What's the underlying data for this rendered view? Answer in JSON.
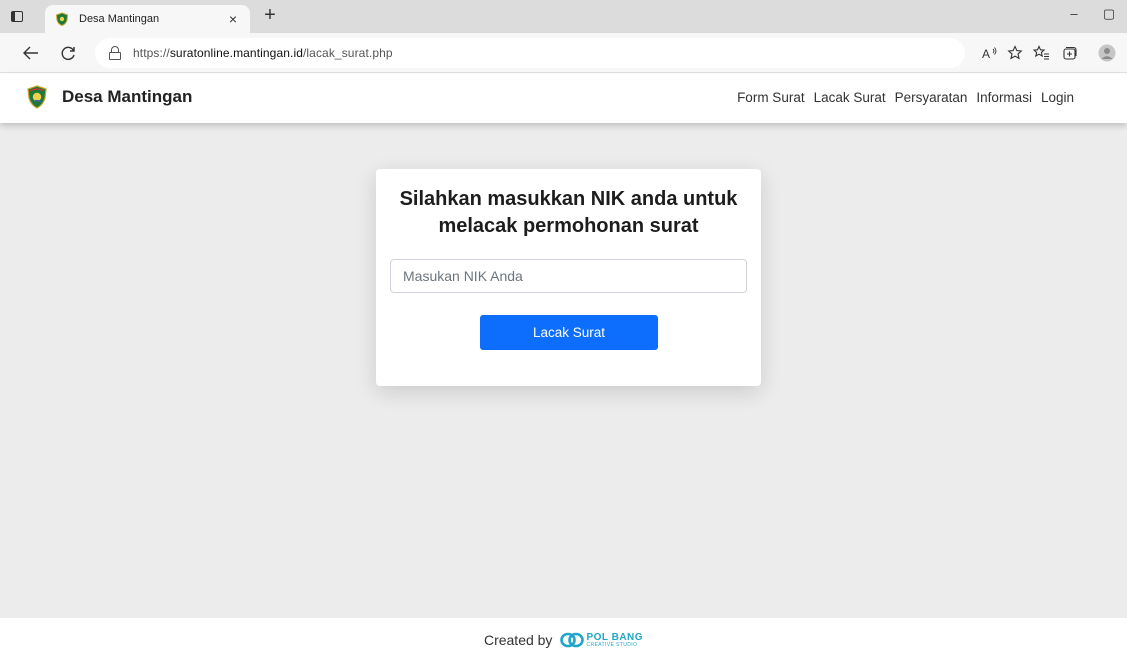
{
  "browser": {
    "tab_title": "Desa Mantingan",
    "tab_close": "×",
    "new_tab": "+",
    "url_prefix": "https://",
    "url_host": "suratonline.mantingan.id",
    "url_path": "/lacak_surat.php",
    "minimize": "–",
    "restore": "▢"
  },
  "site": {
    "brand": "Desa Mantingan",
    "nav": [
      {
        "label": "Form Surat"
      },
      {
        "label": "Lacak Surat"
      },
      {
        "label": "Persyaratan"
      },
      {
        "label": "Informasi"
      },
      {
        "label": "Login"
      }
    ]
  },
  "card": {
    "title": "Silahkan masukkan NIK anda untuk melacak permohonan surat",
    "input_placeholder": "Masukan NIK Anda",
    "button_label": "Lacak Surat"
  },
  "footer": {
    "created_by": "Created by",
    "logo_main": "POL BANG",
    "logo_sub": "CREATIVE STUDIO"
  },
  "colors": {
    "primary_button": "#0d6efd",
    "page_background": "#ececec",
    "footer_logo": "#21a6c9"
  }
}
